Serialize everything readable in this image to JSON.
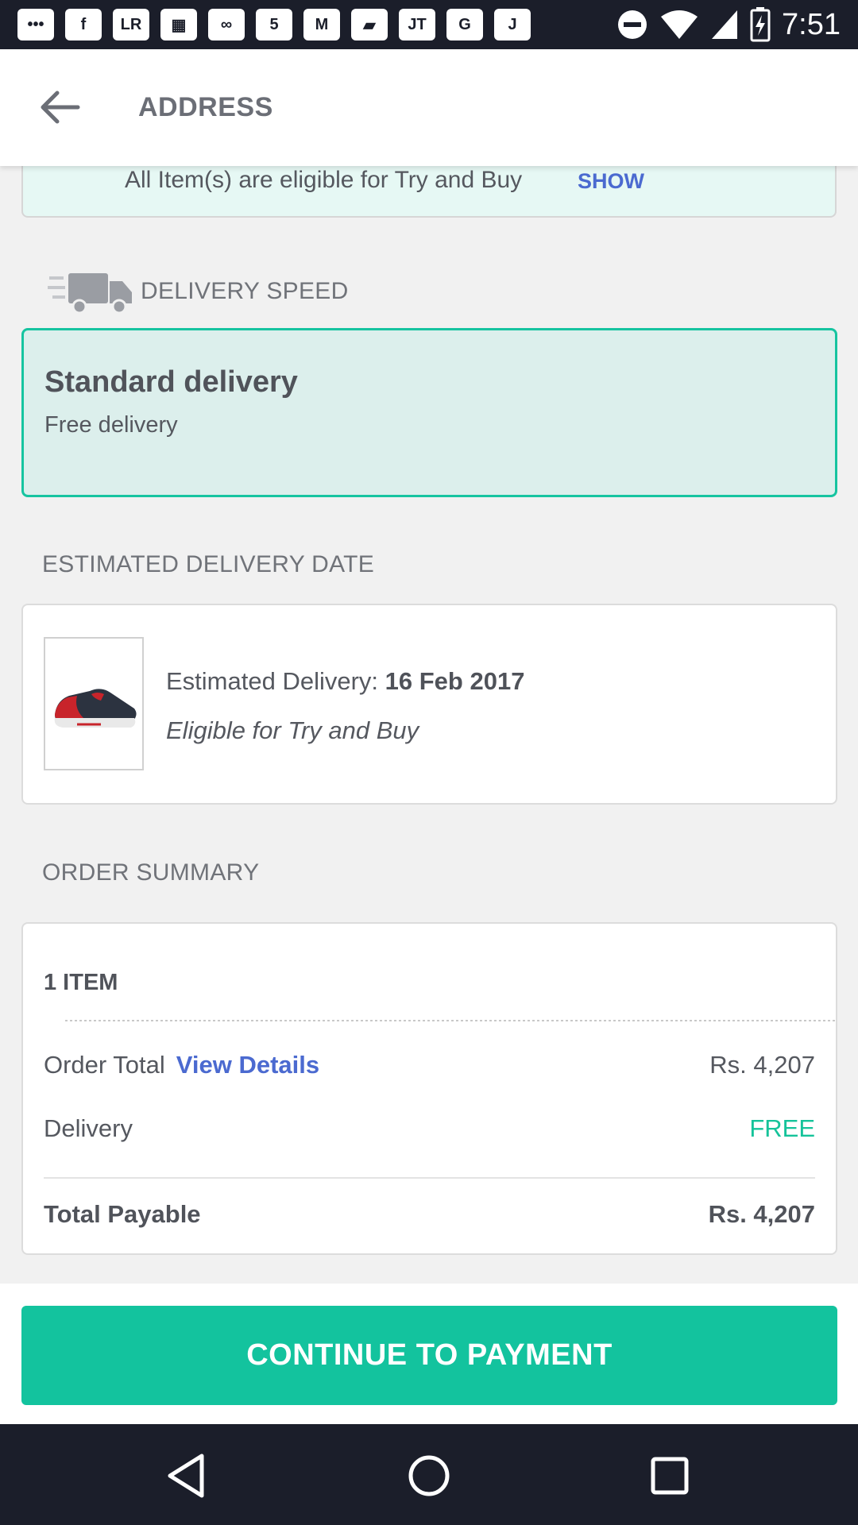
{
  "status_bar": {
    "time": "7:51",
    "notification_icons": [
      "chat-icon",
      "shopping-icon",
      "lr-icon",
      "grid-icon",
      "link-icon",
      "five-icon",
      "gmail-icon",
      "tag-icon",
      "jt-icon",
      "google-icon",
      "j-icon"
    ],
    "icon_glyphs": [
      "•••",
      "f",
      "LR",
      "▦",
      "∞",
      "5",
      "M",
      "▰",
      "JT",
      "G",
      "J"
    ],
    "system_icons": [
      "do-not-disturb-icon",
      "wifi-icon",
      "signal-icon",
      "battery-charging-icon"
    ]
  },
  "app_bar": {
    "title": "ADDRESS"
  },
  "try_buy_banner": {
    "text": "All Item(s) are eligible for Try and Buy",
    "action": "SHOW"
  },
  "delivery_speed": {
    "section_label": "DELIVERY SPEED",
    "selected_option": {
      "title": "Standard delivery",
      "subtitle": "Free delivery"
    }
  },
  "estimated_delivery": {
    "section_label": "ESTIMATED DELIVERY DATE",
    "item": {
      "label": "Estimated Delivery:",
      "date": "16 Feb 2017",
      "note": "Eligible for Try and Buy"
    }
  },
  "order_summary": {
    "section_label": "ORDER SUMMARY",
    "item_count": "1 ITEM",
    "rows": [
      {
        "label": "Order Total",
        "link": "View Details",
        "value": "Rs. 4,207"
      },
      {
        "label": "Delivery",
        "value": "FREE"
      }
    ],
    "total": {
      "label": "Total Payable",
      "value": "Rs. 4,207"
    }
  },
  "cta": {
    "label": "CONTINUE TO PAYMENT"
  },
  "colors": {
    "accent": "#13c39e",
    "link": "#4b6ad0",
    "selected_bg": "#dcefec",
    "banner_bg": "#e6f8f4"
  }
}
